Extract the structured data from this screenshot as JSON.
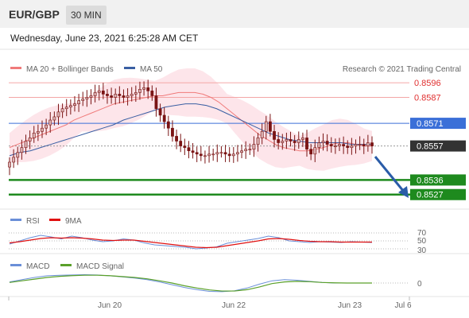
{
  "header": {
    "symbol": "EUR/GBP",
    "timeframe": "30 MIN"
  },
  "timestamp": "Wednesday, June 23, 2021 6:25:28 AM CET",
  "attribution": "Research © 2021 Trading Central",
  "colors": {
    "ma20": "#f07a7a",
    "ma50": "#3a5fa3",
    "bollinger_fill": "#fde0e6",
    "candle": "#7a1414",
    "resistance": "#f4a6a6",
    "pivot": "#3a6fd8",
    "support": "#1e8a1e",
    "current": "#333333",
    "arrow": "#2a5ca8",
    "rsi": "#6a8fd8",
    "rsi_ma": "#e01010",
    "macd": "#6a8fd8",
    "macd_signal": "#5aa02a"
  },
  "chart_data": [
    {
      "type": "candlestick",
      "title": "EUR/GBP",
      "legend": [
        {
          "name": "MA 20 + Bollinger Bands",
          "color": "#f07a7a"
        },
        {
          "name": "MA 50",
          "color": "#3a5fa3"
        }
      ],
      "x_ticks": [
        "Jun 20",
        "Jun 22",
        "Jun 23",
        "Jul 6"
      ],
      "ylim": [
        0.852,
        0.86
      ],
      "levels": [
        {
          "label": "0.8596",
          "value": 0.8596,
          "kind": "resistance"
        },
        {
          "label": "0.8587",
          "value": 0.8587,
          "kind": "resistance"
        },
        {
          "label": "0.8571",
          "value": 0.8571,
          "kind": "pivot"
        },
        {
          "label": "0.8557",
          "value": 0.8557,
          "kind": "current"
        },
        {
          "label": "0.8536",
          "value": 0.8536,
          "kind": "support"
        },
        {
          "label": "0.8527",
          "value": 0.8527,
          "kind": "support"
        }
      ],
      "close_series": [
        0.8547,
        0.855,
        0.8553,
        0.8556,
        0.856,
        0.8562,
        0.8565,
        0.8566,
        0.8568,
        0.857,
        0.8573,
        0.8575,
        0.8578,
        0.858,
        0.8581,
        0.8582,
        0.8583,
        0.8585,
        0.8586,
        0.8587,
        0.8588,
        0.859,
        0.8591,
        0.8589,
        0.8588,
        0.8587,
        0.8589,
        0.8588,
        0.8587,
        0.8588,
        0.8589,
        0.859,
        0.8592,
        0.8593,
        0.8591,
        0.8588,
        0.858,
        0.8576,
        0.8572,
        0.8568,
        0.8563,
        0.856,
        0.8557,
        0.8556,
        0.8554,
        0.8553,
        0.8552,
        0.8551,
        0.8551,
        0.8552,
        0.8552,
        0.8553,
        0.8553,
        0.8552,
        0.8551,
        0.8552,
        0.8553,
        0.8554,
        0.8555,
        0.8555,
        0.8558,
        0.8562,
        0.8566,
        0.8572,
        0.8566,
        0.8561,
        0.8559,
        0.856,
        0.8561,
        0.856,
        0.8559,
        0.8561,
        0.8562,
        0.8555,
        0.8552,
        0.8556,
        0.8559,
        0.856,
        0.8558,
        0.8557,
        0.8557,
        0.8558,
        0.8557,
        0.8556,
        0.8557,
        0.8558,
        0.8558,
        0.8557,
        0.8559,
        0.8557
      ],
      "ma20_series": [
        0.8556,
        0.8558,
        0.856,
        0.8562,
        0.8564,
        0.8566,
        0.8568,
        0.857,
        0.8573,
        0.8575,
        0.8577,
        0.8579,
        0.8581,
        0.8583,
        0.8584,
        0.8585,
        0.8586,
        0.8587,
        0.8588,
        0.8588,
        0.8589,
        0.859,
        0.859,
        0.859,
        0.8589,
        0.8587,
        0.8584,
        0.858,
        0.8576,
        0.8572,
        0.8568,
        0.8564,
        0.8561,
        0.8558,
        0.8556,
        0.8555,
        0.8554,
        0.8554,
        0.8555,
        0.8556,
        0.8558,
        0.8559,
        0.8559,
        0.8558,
        0.8557,
        0.8557
      ],
      "ma50_series": [
        0.8551,
        0.8553,
        0.8554,
        0.8556,
        0.8558,
        0.856,
        0.8562,
        0.8564,
        0.8566,
        0.8568,
        0.857,
        0.8573,
        0.8575,
        0.8577,
        0.8579,
        0.8581,
        0.8582,
        0.8583,
        0.8583,
        0.8582,
        0.858,
        0.8577,
        0.8574,
        0.8571,
        0.8568,
        0.8565,
        0.8563,
        0.8561,
        0.856,
        0.8559,
        0.8559,
        0.8559,
        0.8559,
        0.8558,
        0.8558,
        0.8558
      ]
    },
    {
      "type": "line",
      "title": "RSI",
      "legend": [
        {
          "name": "RSI",
          "color": "#6a8fd8"
        },
        {
          "name": "9MA",
          "color": "#e01010"
        }
      ],
      "y_ticks": [
        "70",
        "50",
        "30"
      ],
      "ylim": [
        20,
        80
      ],
      "series": [
        {
          "name": "RSI",
          "values": [
            42,
            50,
            58,
            64,
            60,
            55,
            62,
            58,
            52,
            48,
            50,
            55,
            52,
            45,
            40,
            38,
            36,
            34,
            30,
            32,
            35,
            44,
            48,
            52,
            56,
            62,
            58,
            50,
            48,
            46,
            48,
            47,
            46,
            48,
            47,
            46
          ]
        },
        {
          "name": "9MA",
          "values": [
            45,
            48,
            52,
            56,
            58,
            57,
            58,
            57,
            55,
            52,
            51,
            52,
            52,
            49,
            46,
            43,
            40,
            37,
            34,
            33,
            34,
            38,
            42,
            46,
            50,
            55,
            56,
            54,
            51,
            49,
            48,
            48,
            47,
            47,
            47,
            47
          ]
        }
      ]
    },
    {
      "type": "line",
      "title": "MACD",
      "legend": [
        {
          "name": "MACD",
          "color": "#6a8fd8"
        },
        {
          "name": "MACD Signal",
          "color": "#5aa02a"
        }
      ],
      "y_ticks": [
        "0"
      ],
      "ylim": [
        -1,
        1
      ],
      "series": [
        {
          "name": "MACD",
          "values": [
            0.1,
            0.3,
            0.5,
            0.65,
            0.7,
            0.72,
            0.75,
            0.72,
            0.65,
            0.55,
            0.45,
            0.3,
            0.1,
            -0.15,
            -0.4,
            -0.6,
            -0.75,
            -0.78,
            -0.7,
            -0.45,
            -0.1,
            0.2,
            0.3,
            0.25,
            0.15,
            0.05,
            0.0,
            0.0,
            0.0,
            0.0
          ]
        },
        {
          "name": "MACD Signal",
          "values": [
            0.05,
            0.2,
            0.35,
            0.5,
            0.6,
            0.66,
            0.7,
            0.7,
            0.66,
            0.58,
            0.5,
            0.38,
            0.2,
            0.0,
            -0.25,
            -0.45,
            -0.62,
            -0.72,
            -0.72,
            -0.6,
            -0.35,
            -0.05,
            0.1,
            0.15,
            0.12,
            0.05,
            0.02,
            0.0,
            0.0,
            0.0
          ]
        }
      ]
    }
  ]
}
